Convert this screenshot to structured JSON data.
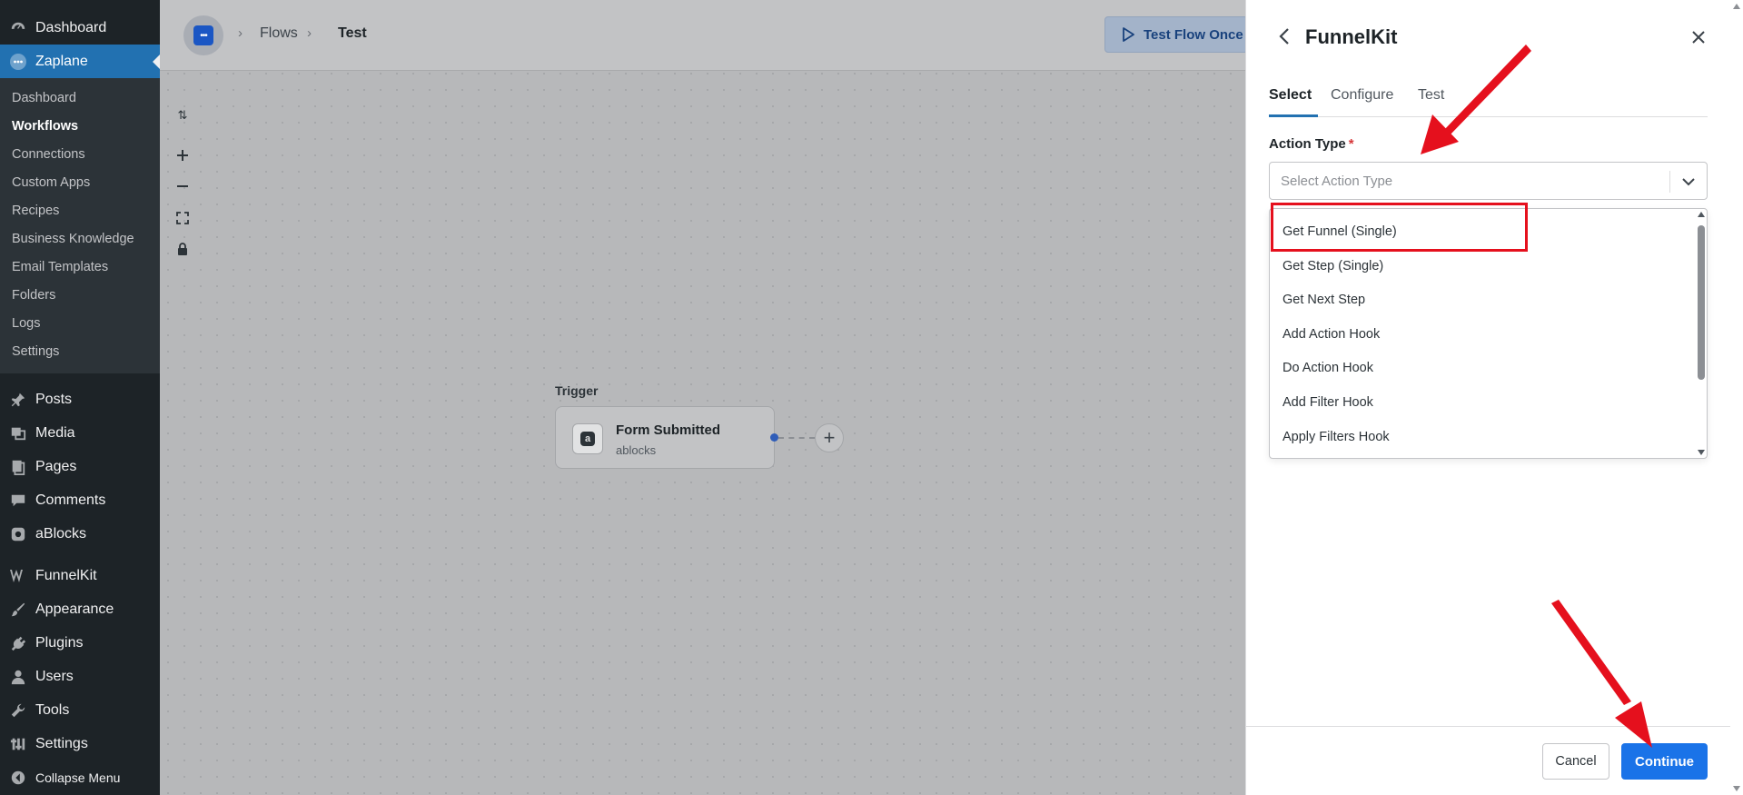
{
  "colors": {
    "wp_sidebar": "#1d2327",
    "wp_accent": "#2271b1",
    "primary_button": "#1a73e8",
    "annotation_red": "#e5101d"
  },
  "sidebar": {
    "top_items": [
      {
        "label": "Dashboard",
        "icon": "dashboard-icon"
      },
      {
        "label": "Zaplane",
        "icon": "zaplane-icon",
        "current": true
      }
    ],
    "submenu": [
      {
        "label": "Dashboard"
      },
      {
        "label": "Workflows",
        "active": true
      },
      {
        "label": "Connections"
      },
      {
        "label": "Custom Apps"
      },
      {
        "label": "Recipes"
      },
      {
        "label": "Business Knowledge"
      },
      {
        "label": "Email Templates"
      },
      {
        "label": "Folders"
      },
      {
        "label": "Logs"
      },
      {
        "label": "Settings"
      }
    ],
    "group1": [
      {
        "label": "Posts",
        "icon": "pin-icon"
      },
      {
        "label": "Media",
        "icon": "media-icon"
      },
      {
        "label": "Pages",
        "icon": "pages-icon"
      },
      {
        "label": "Comments",
        "icon": "comment-icon"
      },
      {
        "label": "aBlocks",
        "icon": "ablocks-icon"
      }
    ],
    "group2": [
      {
        "label": "FunnelKit",
        "icon": "funnelkit-icon"
      },
      {
        "label": "Appearance",
        "icon": "brush-icon"
      },
      {
        "label": "Plugins",
        "icon": "plug-icon"
      },
      {
        "label": "Users",
        "icon": "user-icon"
      },
      {
        "label": "Tools",
        "icon": "wrench-icon"
      },
      {
        "label": "Settings",
        "icon": "settings-icon"
      },
      {
        "label": "Collapse Menu",
        "icon": "collapse-icon"
      }
    ]
  },
  "topbar": {
    "breadcrumb": [
      "Flows",
      "Test"
    ],
    "test_button": "Test Flow Once"
  },
  "canvas": {
    "tools": [
      "sort-icon",
      "zoom-in-icon",
      "zoom-out-icon",
      "fit-view-icon",
      "lock-icon"
    ],
    "trigger_label": "Trigger",
    "node": {
      "title": "Form Submitted",
      "subtitle": "ablocks"
    }
  },
  "drawer": {
    "title": "FunnelKit",
    "tabs": [
      "Select",
      "Configure",
      "Test"
    ],
    "active_tab": "Select",
    "field_label": "Action Type",
    "required_mark": "*",
    "select_placeholder": "Select Action Type",
    "options": [
      "Get Funnel (Single)",
      "Get Step (Single)",
      "Get Next Step",
      "Add Action Hook",
      "Do Action Hook",
      "Add Filter Hook",
      "Apply Filters Hook"
    ],
    "highlighted_option": "Get Funnel (Single)",
    "cancel_label": "Cancel",
    "continue_label": "Continue"
  }
}
